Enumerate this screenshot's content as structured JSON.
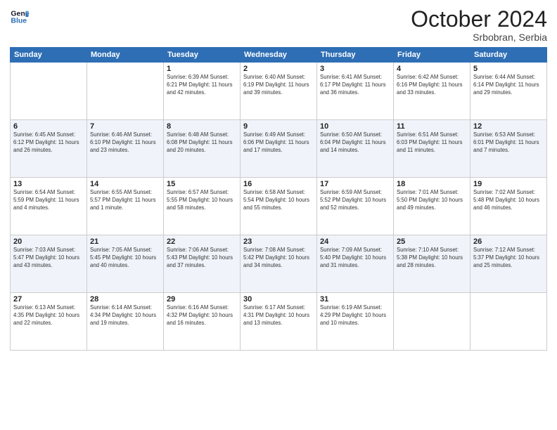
{
  "header": {
    "logo_line1": "General",
    "logo_line2": "Blue",
    "month": "October 2024",
    "location": "Srbobran, Serbia"
  },
  "weekdays": [
    "Sunday",
    "Monday",
    "Tuesday",
    "Wednesday",
    "Thursday",
    "Friday",
    "Saturday"
  ],
  "weeks": [
    [
      {
        "day": "",
        "info": ""
      },
      {
        "day": "",
        "info": ""
      },
      {
        "day": "1",
        "info": "Sunrise: 6:39 AM\nSunset: 6:21 PM\nDaylight: 11 hours\nand 42 minutes."
      },
      {
        "day": "2",
        "info": "Sunrise: 6:40 AM\nSunset: 6:19 PM\nDaylight: 11 hours\nand 39 minutes."
      },
      {
        "day": "3",
        "info": "Sunrise: 6:41 AM\nSunset: 6:17 PM\nDaylight: 11 hours\nand 36 minutes."
      },
      {
        "day": "4",
        "info": "Sunrise: 6:42 AM\nSunset: 6:16 PM\nDaylight: 11 hours\nand 33 minutes."
      },
      {
        "day": "5",
        "info": "Sunrise: 6:44 AM\nSunset: 6:14 PM\nDaylight: 11 hours\nand 29 minutes."
      }
    ],
    [
      {
        "day": "6",
        "info": "Sunrise: 6:45 AM\nSunset: 6:12 PM\nDaylight: 11 hours\nand 26 minutes."
      },
      {
        "day": "7",
        "info": "Sunrise: 6:46 AM\nSunset: 6:10 PM\nDaylight: 11 hours\nand 23 minutes."
      },
      {
        "day": "8",
        "info": "Sunrise: 6:48 AM\nSunset: 6:08 PM\nDaylight: 11 hours\nand 20 minutes."
      },
      {
        "day": "9",
        "info": "Sunrise: 6:49 AM\nSunset: 6:06 PM\nDaylight: 11 hours\nand 17 minutes."
      },
      {
        "day": "10",
        "info": "Sunrise: 6:50 AM\nSunset: 6:04 PM\nDaylight: 11 hours\nand 14 minutes."
      },
      {
        "day": "11",
        "info": "Sunrise: 6:51 AM\nSunset: 6:03 PM\nDaylight: 11 hours\nand 11 minutes."
      },
      {
        "day": "12",
        "info": "Sunrise: 6:53 AM\nSunset: 6:01 PM\nDaylight: 11 hours\nand 7 minutes."
      }
    ],
    [
      {
        "day": "13",
        "info": "Sunrise: 6:54 AM\nSunset: 5:59 PM\nDaylight: 11 hours\nand 4 minutes."
      },
      {
        "day": "14",
        "info": "Sunrise: 6:55 AM\nSunset: 5:57 PM\nDaylight: 11 hours\nand 1 minute."
      },
      {
        "day": "15",
        "info": "Sunrise: 6:57 AM\nSunset: 5:55 PM\nDaylight: 10 hours\nand 58 minutes."
      },
      {
        "day": "16",
        "info": "Sunrise: 6:58 AM\nSunset: 5:54 PM\nDaylight: 10 hours\nand 55 minutes."
      },
      {
        "day": "17",
        "info": "Sunrise: 6:59 AM\nSunset: 5:52 PM\nDaylight: 10 hours\nand 52 minutes."
      },
      {
        "day": "18",
        "info": "Sunrise: 7:01 AM\nSunset: 5:50 PM\nDaylight: 10 hours\nand 49 minutes."
      },
      {
        "day": "19",
        "info": "Sunrise: 7:02 AM\nSunset: 5:48 PM\nDaylight: 10 hours\nand 46 minutes."
      }
    ],
    [
      {
        "day": "20",
        "info": "Sunrise: 7:03 AM\nSunset: 5:47 PM\nDaylight: 10 hours\nand 43 minutes."
      },
      {
        "day": "21",
        "info": "Sunrise: 7:05 AM\nSunset: 5:45 PM\nDaylight: 10 hours\nand 40 minutes."
      },
      {
        "day": "22",
        "info": "Sunrise: 7:06 AM\nSunset: 5:43 PM\nDaylight: 10 hours\nand 37 minutes."
      },
      {
        "day": "23",
        "info": "Sunrise: 7:08 AM\nSunset: 5:42 PM\nDaylight: 10 hours\nand 34 minutes."
      },
      {
        "day": "24",
        "info": "Sunrise: 7:09 AM\nSunset: 5:40 PM\nDaylight: 10 hours\nand 31 minutes."
      },
      {
        "day": "25",
        "info": "Sunrise: 7:10 AM\nSunset: 5:38 PM\nDaylight: 10 hours\nand 28 minutes."
      },
      {
        "day": "26",
        "info": "Sunrise: 7:12 AM\nSunset: 5:37 PM\nDaylight: 10 hours\nand 25 minutes."
      }
    ],
    [
      {
        "day": "27",
        "info": "Sunrise: 6:13 AM\nSunset: 4:35 PM\nDaylight: 10 hours\nand 22 minutes."
      },
      {
        "day": "28",
        "info": "Sunrise: 6:14 AM\nSunset: 4:34 PM\nDaylight: 10 hours\nand 19 minutes."
      },
      {
        "day": "29",
        "info": "Sunrise: 6:16 AM\nSunset: 4:32 PM\nDaylight: 10 hours\nand 16 minutes."
      },
      {
        "day": "30",
        "info": "Sunrise: 6:17 AM\nSunset: 4:31 PM\nDaylight: 10 hours\nand 13 minutes."
      },
      {
        "day": "31",
        "info": "Sunrise: 6:19 AM\nSunset: 4:29 PM\nDaylight: 10 hours\nand 10 minutes."
      },
      {
        "day": "",
        "info": ""
      },
      {
        "day": "",
        "info": ""
      }
    ]
  ]
}
